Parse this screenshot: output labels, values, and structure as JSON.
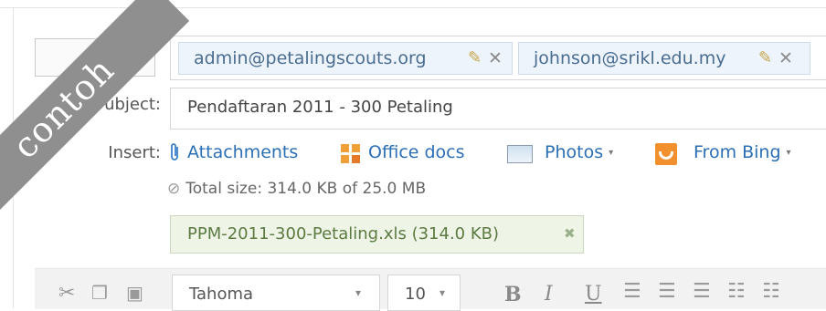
{
  "recipients": [
    {
      "email": "admin@petalingscouts.org",
      "edit_icon": "pencil-icon",
      "remove_label": "✕"
    },
    {
      "email": "johnson@srikl.edu.my",
      "edit_icon": "pencil-icon",
      "remove_label": "✕"
    }
  ],
  "subject": {
    "label": "ubject:",
    "value": "Pendaftaran 2011 - 300 Petaling"
  },
  "insert": {
    "label": "Insert:",
    "items": [
      {
        "label": "Attachments",
        "icon": "paperclip-icon"
      },
      {
        "label": "Office docs",
        "icon": "office-docs-icon"
      },
      {
        "label": "Photos",
        "icon": "photos-icon",
        "dropdown": "▾"
      },
      {
        "label": "From Bing",
        "icon": "bing-icon",
        "dropdown": "▾"
      }
    ]
  },
  "total_size": "Total size: 314.0 KB of 25.0 MB",
  "attachment": {
    "name": "PPM-2011-300-Petaling.xls  (314.0 KB)",
    "remove": "✖"
  },
  "toolbar": {
    "font": "Tahoma",
    "size": "10",
    "bold": "B",
    "italic": "I",
    "underline": "U",
    "dropdown_caret": "▾"
  },
  "watermark": "contoh",
  "colors": {
    "link": "#2b6fb5",
    "chip_bg": "#eef4fb",
    "attachment_bg": "#eef5e7",
    "watermark": "#8f8f8f"
  }
}
